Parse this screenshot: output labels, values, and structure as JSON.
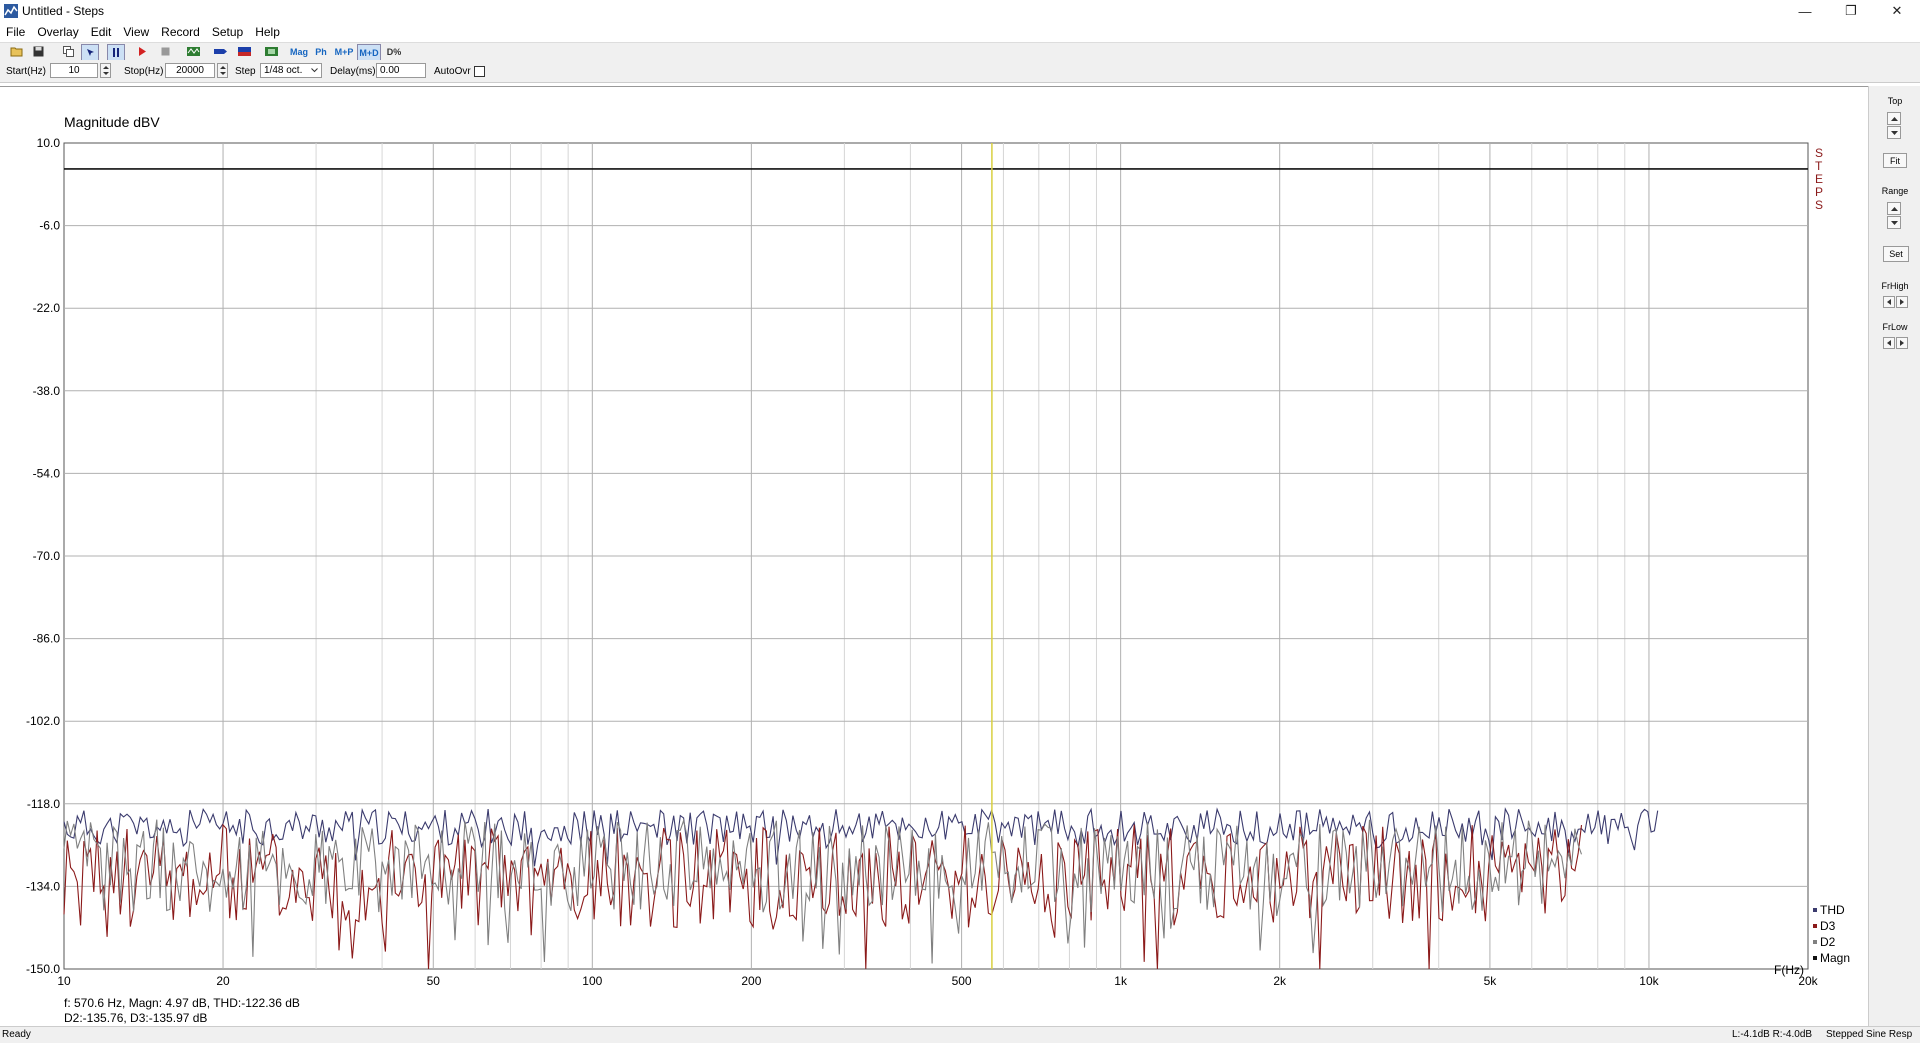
{
  "window": {
    "title": "Untitled - Steps",
    "minimize": "—",
    "restore": "❐",
    "close": "✕"
  },
  "menu": [
    "File",
    "Overlay",
    "Edit",
    "View",
    "Record",
    "Setup",
    "Help"
  ],
  "toolbar": {
    "mag": "Mag",
    "ph": "Ph",
    "mp": "M+P",
    "md": "M+D",
    "pct": "D%"
  },
  "params": {
    "start_label": "Start(Hz)",
    "start_value": "10",
    "stop_label": "Stop(Hz)",
    "stop_value": "20000",
    "step_label": "Step",
    "step_value": "1/48 oct.",
    "delay_label": "Delay(ms)",
    "delay_value": "0.00",
    "autoovr_label": "AutoOvr"
  },
  "right_panel": {
    "top": "Top",
    "fit": "Fit",
    "range": "Range",
    "set": "Set",
    "frhigh": "FrHigh",
    "frlow": "FrLow"
  },
  "chart_data": {
    "type": "line",
    "title": "Magnitude dBV",
    "xlabel": "F(Hz)",
    "x_scale": "log",
    "xlim": [
      10,
      20000
    ],
    "ylim": [
      -150,
      10
    ],
    "grid": true,
    "brand": "STEPS",
    "y_ticks": [
      "10.0",
      "-6.0",
      "-22.0",
      "-38.0",
      "-54.0",
      "-70.0",
      "-86.0",
      "-102.0",
      "-118.0",
      "-134.0",
      "-150.0"
    ],
    "x_tick_labels": [
      {
        "v": 10,
        "t": "10"
      },
      {
        "v": 20,
        "t": "20"
      },
      {
        "v": 50,
        "t": "50"
      },
      {
        "v": 100,
        "t": "100"
      },
      {
        "v": 200,
        "t": "200"
      },
      {
        "v": 500,
        "t": "500"
      },
      {
        "v": 1000,
        "t": "1k"
      },
      {
        "v": 2000,
        "t": "2k"
      },
      {
        "v": 5000,
        "t": "5k"
      },
      {
        "v": 10000,
        "t": "10k"
      },
      {
        "v": 20000,
        "t": "20k"
      }
    ],
    "cursor_hz": 570.6,
    "readout_line1": "f:  570.6 Hz, Magn: 4.97 dB, THD:-122.36  dB",
    "readout_line2": "D2:-135.76, D3:-135.97 dB",
    "series": [
      {
        "name": "THD",
        "color": "#3b3b6e",
        "x_end": 10500,
        "mean": -122.5,
        "spread": 3.5,
        "seed": 11
      },
      {
        "name": "D3",
        "color": "#8b1a1a",
        "x_end": 7500,
        "mean": -132.0,
        "spread": 10,
        "seed": 23
      },
      {
        "name": "D2",
        "color": "#808080",
        "x_end": 7500,
        "mean": -130.0,
        "spread": 9,
        "seed": 37
      },
      {
        "name": "Magn",
        "color": "#111111",
        "x_end": 20000,
        "value": 4.97
      }
    ]
  },
  "status": {
    "left": "Ready",
    "levels": "L:-4.1dB  R:-4.0dB",
    "mode": "Stepped Sine Resp"
  }
}
